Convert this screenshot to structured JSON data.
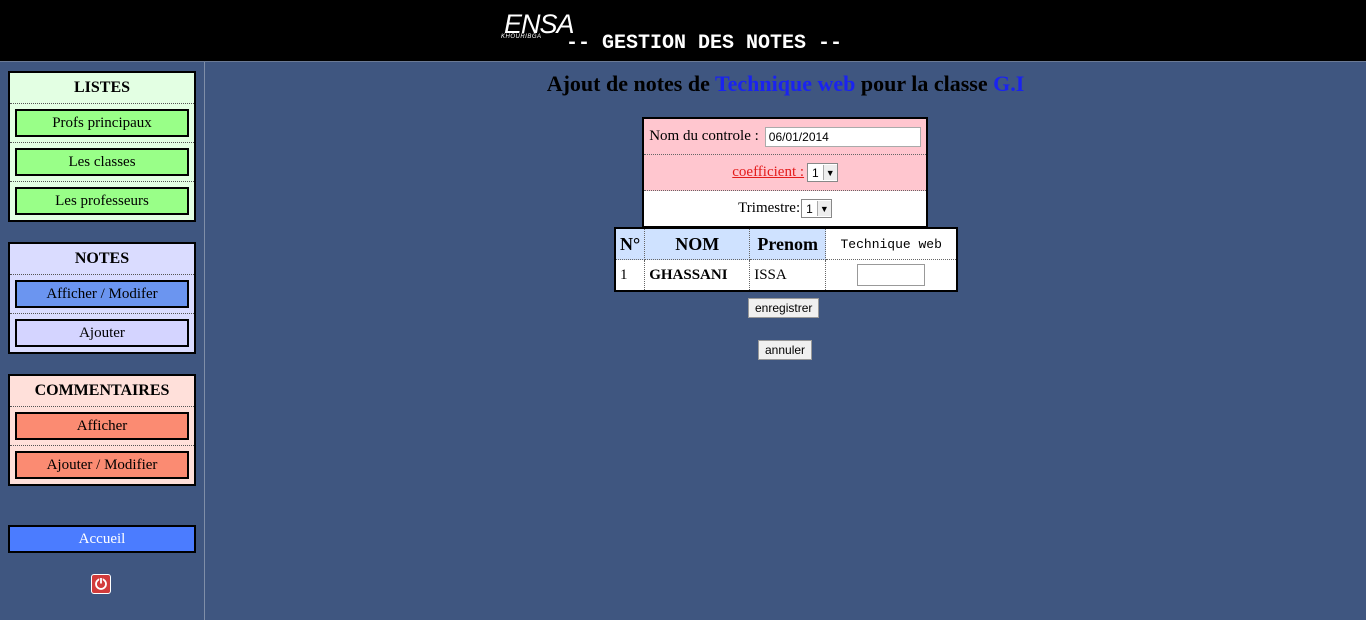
{
  "header": {
    "logo_word": "ENSA",
    "logo_city": "KHOURIBGA",
    "title": "-- GESTION DES NOTES --"
  },
  "sidebar": {
    "listes": {
      "title": "LISTES",
      "items": [
        "Profs principaux",
        "Les classes",
        "Les professeurs"
      ]
    },
    "notes": {
      "title": "NOTES",
      "items": [
        "Afficher / Modifer",
        "Ajouter"
      ]
    },
    "commentaires": {
      "title": "COMMENTAIRES",
      "items": [
        "Afficher",
        "Ajouter / Modifier"
      ]
    },
    "accueil": "Accueil",
    "power_icon": "power-icon"
  },
  "main": {
    "title_prefix": "Ajout de notes de",
    "subject": "Technique web",
    "title_mid": "pour la classe",
    "class_name": "G.I",
    "form": {
      "controle_label": "Nom du controle :",
      "controle_value": "06/01/2014",
      "coef_label": "coefficient :",
      "coef_value": "1",
      "trimestre_label": "Trimestre:",
      "trimestre_value": "1"
    },
    "table": {
      "headers": [
        "N°",
        "NOM",
        "Prenom",
        "Technique web"
      ],
      "rows": [
        {
          "num": "1",
          "nom": "GHASSANI",
          "prenom": "ISSA",
          "note": ""
        }
      ]
    },
    "buttons": {
      "save": "enregistrer",
      "cancel": "annuler"
    }
  },
  "colors": {
    "background": "#3f5680",
    "accent_blue": "#1a23f0",
    "listes_button": "#99ff88",
    "notes_button_active": "#6b95f0",
    "comment_button": "#fb8b72",
    "accueil": "#4b7cff"
  }
}
